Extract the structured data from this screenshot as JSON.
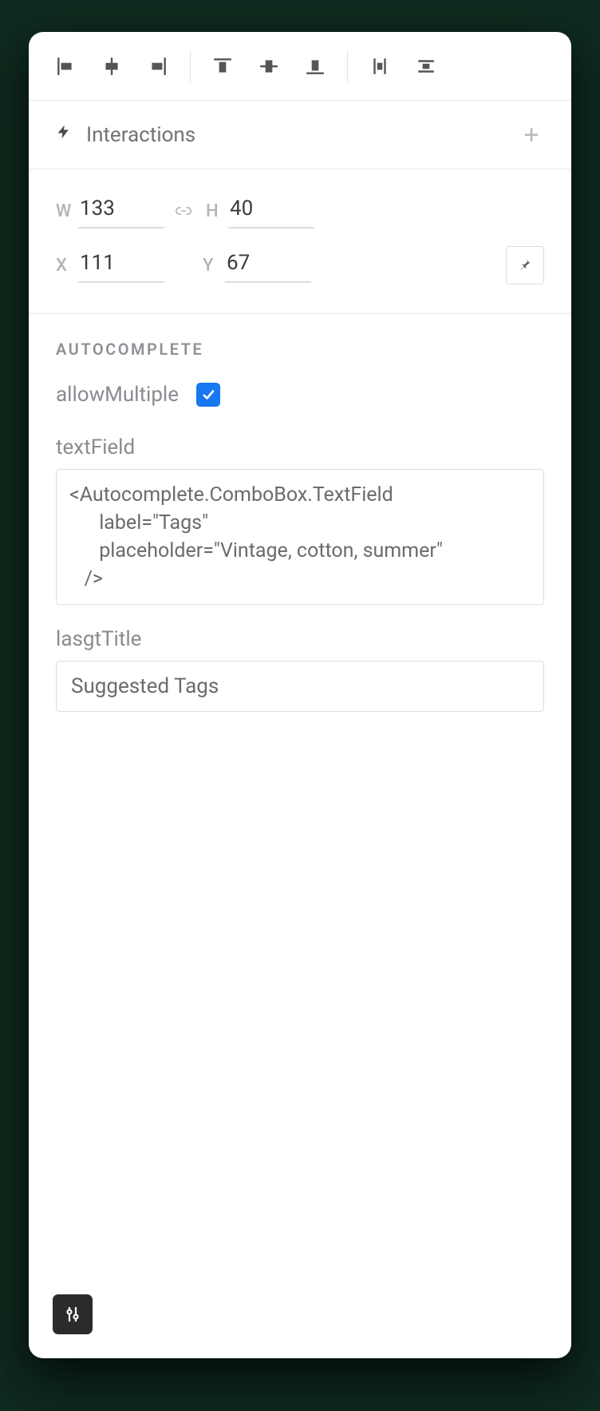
{
  "interactions": {
    "title": "Interactions"
  },
  "dims": {
    "w_label": "W",
    "w_value": "133",
    "h_label": "H",
    "h_value": "40",
    "x_label": "X",
    "x_value": "111",
    "y_label": "Y",
    "y_value": "67"
  },
  "section": {
    "title": "AUTOCOMPLETE",
    "allowMultiple_label": "allowMultiple",
    "allowMultiple_checked": true,
    "textField_label": "textField",
    "textField_value": "<Autocomplete.ComboBox.TextField\n      label=\"Tags\"\n      placeholder=\"Vintage, cotton, summer\"\n   />",
    "lasgtTitle_label": "lasgtTitle",
    "lasgtTitle_value": "Suggested Tags"
  },
  "icons": {
    "align_left": "align-left-icon",
    "align_hcenter": "align-h-center-icon",
    "align_right": "align-right-icon",
    "align_top": "align-top-icon",
    "align_vcenter": "align-v-center-icon",
    "align_bottom": "align-bottom-icon",
    "distribute_h": "distribute-h-icon",
    "distribute_v": "distribute-v-icon",
    "bolt": "lightning-icon",
    "add": "plus-icon",
    "link": "link-size-icon",
    "pin": "pin-icon",
    "sliders": "sliders-icon"
  }
}
